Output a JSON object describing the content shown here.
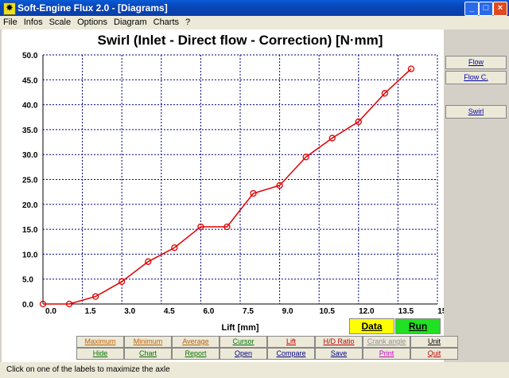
{
  "window": {
    "title": "Soft-Engine Flux 2.0 - [Diagrams]",
    "app_icon": "flux-app-icon"
  },
  "menu": [
    "File",
    "Infos",
    "Scale",
    "Options",
    "Diagram",
    "Charts",
    "?"
  ],
  "chart_data": {
    "type": "line",
    "title": "Swirl (Inlet - Direct flow - Correction) [N·mm]",
    "xlabel": "Lift [mm]",
    "ylabel": "",
    "xlim": [
      0,
      15
    ],
    "ylim": [
      0,
      50
    ],
    "x_ticks": [
      "0.0",
      "1.5",
      "3.0",
      "4.5",
      "6.0",
      "7.5",
      "9.0",
      "10.5",
      "12.0",
      "13.5",
      "15.0"
    ],
    "y_ticks": [
      "50.0",
      "45.0",
      "40.0",
      "35.0",
      "30.0",
      "25.0",
      "20.0",
      "15.0",
      "10.0",
      "5.0",
      "0.0"
    ],
    "grid": true,
    "series": [
      {
        "color": "#e00000",
        "x": [
          0,
          1,
          2,
          3,
          4,
          5,
          6,
          7,
          8,
          9,
          10,
          11,
          12,
          13,
          14
        ],
        "y": [
          0,
          0,
          1.5,
          4.5,
          8.5,
          11.3,
          15.5,
          15.5,
          22.2,
          23.8,
          29.5,
          33.3,
          36.6,
          42.3,
          47.2
        ]
      }
    ]
  },
  "side_buttons": [
    "Flow",
    "Flow C.",
    "Swirl"
  ],
  "action_buttons": {
    "data": {
      "label": "Data",
      "color": "#ffff00"
    },
    "run": {
      "label": "Run",
      "color": "#22e022"
    }
  },
  "bottom_row1": [
    "Maximum",
    "Minimum",
    "Average",
    "Cursor",
    "Lift",
    "H/D Ratio",
    "Crank angle",
    "Unit"
  ],
  "bottom_row2": [
    "Hide",
    "Chart",
    "Report",
    "Open",
    "Compare",
    "Save",
    "Print",
    "Quit"
  ],
  "status": "Click on one of the labels to maximize the axle"
}
